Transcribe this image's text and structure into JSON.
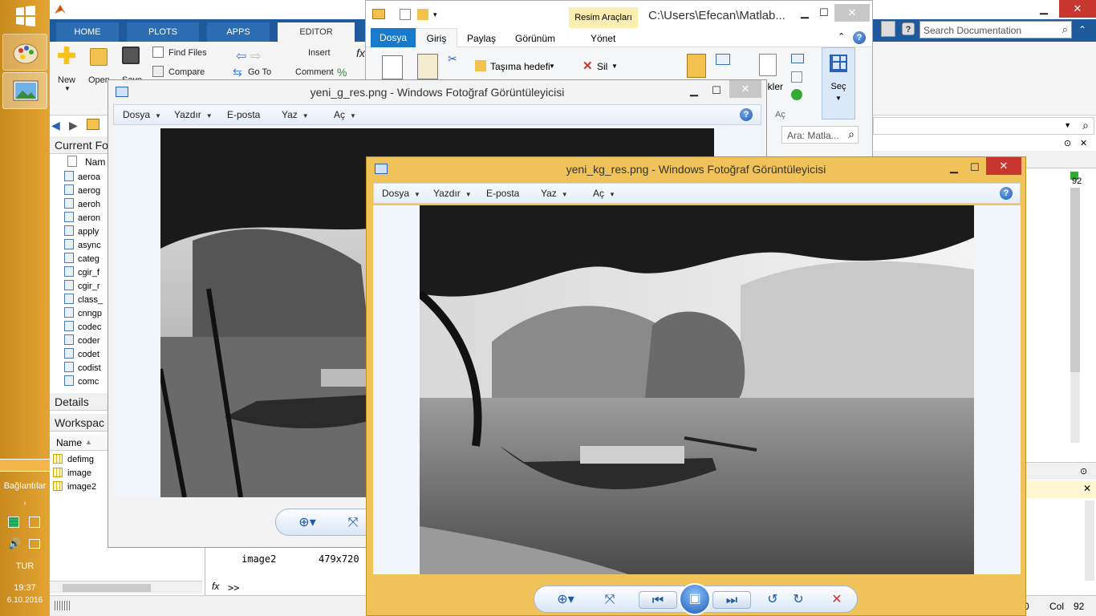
{
  "taskbar": {
    "lang_label": "Bağlantılar",
    "input_lang": "TUR",
    "time": "19:37",
    "date": "6.10.2016"
  },
  "matlab": {
    "tabs": [
      "HOME",
      "PLOTS",
      "APPS",
      "EDITOR"
    ],
    "ribbon": {
      "new": "New",
      "open": "Open",
      "save": "Save",
      "find_files": "Find Files",
      "compare": "Compare",
      "go_to": "Go To",
      "insert": "Insert",
      "comment": "Comment",
      "fx": "fx"
    },
    "search_placeholder": "Search Documentation",
    "current_folder_title": "Current Fo",
    "col_name": "Nam",
    "files": [
      "aeroa",
      "aerog",
      "aeroh",
      "aeron",
      "apply",
      "async",
      "categ",
      "cgir_f",
      "cgir_r",
      "class_",
      "cnngp",
      "codec",
      "coder",
      "codet",
      "codist",
      "comc"
    ],
    "details_title": "Details",
    "workspace_title": "Workspac",
    "ws_col_name": "Name",
    "ws_vars": [
      "defimg",
      "image",
      "image2"
    ],
    "cmd_line_var": "image2",
    "cmd_line_size": "479x720",
    "prompt": ">>",
    "status_col_label": "Col",
    "status_col": "92",
    "status_ln": "0"
  },
  "explorer": {
    "context_tab": "Resim Araçları",
    "path": "C:\\Users\\Efecan\\Matlab...",
    "tabs": [
      "Dosya",
      "Giriş",
      "Paylaş",
      "Görünüm",
      "Yönet"
    ],
    "move_to": "Taşıma hedefi",
    "delete": "Sil",
    "select": "Seç",
    "properties_frag": "ikler",
    "open_frag": "Aç",
    "search_placeholder": "Ara: Matla..."
  },
  "viewer1": {
    "title": "yeni_g_res.png - Windows Fotoğraf Görüntüleyicisi",
    "menu": [
      "Dosya",
      "Yazdır",
      "E-posta",
      "Yaz",
      "Aç"
    ]
  },
  "viewer2": {
    "title": "yeni_kg_res.png - Windows Fotoğraf Görüntüleyicisi",
    "menu": [
      "Dosya",
      "Yazdır",
      "E-posta",
      "Yaz",
      "Aç"
    ]
  },
  "colors": {
    "taskbar": "#d89a2a",
    "matlab_tabs": "#1e5a9c",
    "viewer_frame": "#f0c35a",
    "close_red": "#c7372f"
  }
}
